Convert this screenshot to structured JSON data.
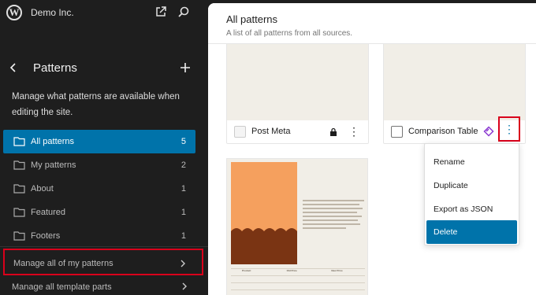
{
  "site": {
    "name": "Demo Inc."
  },
  "sidebar": {
    "title": "Patterns",
    "description": "Manage what patterns are available when editing the site.",
    "items": [
      {
        "label": "All patterns",
        "count": "5"
      },
      {
        "label": "My patterns",
        "count": "2"
      },
      {
        "label": "About",
        "count": "1"
      },
      {
        "label": "Featured",
        "count": "1"
      },
      {
        "label": "Footers",
        "count": "1"
      }
    ],
    "manage": [
      {
        "label": "Manage all of my patterns"
      },
      {
        "label": "Manage all template parts"
      }
    ]
  },
  "main": {
    "title": "All patterns",
    "subtitle": "A list of all patterns from all sources."
  },
  "cards": [
    {
      "title": "Post Meta"
    },
    {
      "title": "Comparison Table"
    }
  ],
  "menu": {
    "items": [
      "Rename",
      "Duplicate",
      "Export as JSON",
      "Delete"
    ]
  },
  "preview_table": {
    "headers": [
      "Product",
      "Old Price",
      "New Price"
    ]
  },
  "colors": {
    "accent": "#0073aa",
    "highlight": "#d9001b",
    "synced": "#8c3bd1",
    "sidebar_bg": "#1e1e1e"
  }
}
